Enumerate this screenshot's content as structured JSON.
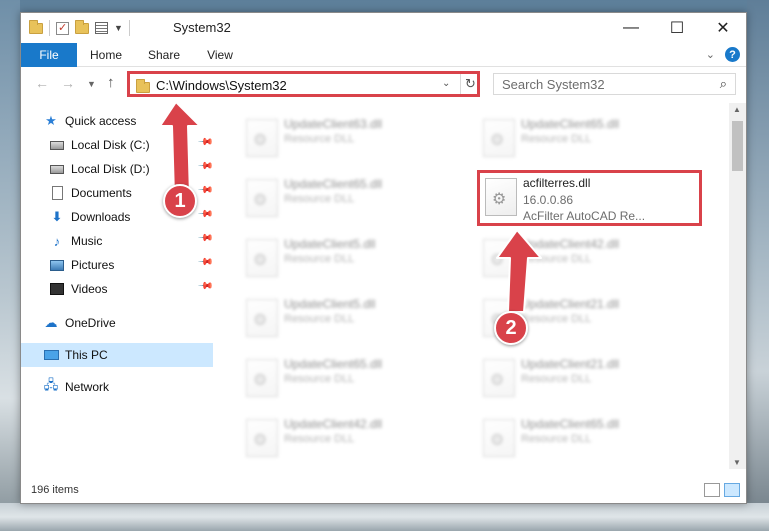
{
  "window": {
    "title": "System32"
  },
  "ribbon": {
    "tabs": [
      "File",
      "Home",
      "Share",
      "View"
    ]
  },
  "titlebar_buttons": {
    "minimize": "—",
    "maximize": "☐",
    "close": "✕"
  },
  "address": {
    "path": "C:\\Windows\\System32",
    "search_placeholder": "Search System32"
  },
  "sidebar": {
    "items": [
      {
        "label": "Quick access",
        "icon": "star-icon"
      },
      {
        "label": "Local Disk (C:)",
        "icon": "drive-icon",
        "pinned": true
      },
      {
        "label": "Local Disk (D:)",
        "icon": "drive-icon",
        "pinned": true
      },
      {
        "label": "Documents",
        "icon": "document-icon",
        "pinned": true
      },
      {
        "label": "Downloads",
        "icon": "download-icon",
        "pinned": true
      },
      {
        "label": "Music",
        "icon": "music-icon",
        "pinned": true
      },
      {
        "label": "Pictures",
        "icon": "pictures-icon",
        "pinned": true
      },
      {
        "label": "Videos",
        "icon": "video-icon",
        "pinned": true
      },
      {
        "label": "OneDrive",
        "icon": "cloud-icon"
      },
      {
        "label": "This PC",
        "icon": "computer-icon",
        "selected": true
      },
      {
        "label": "Network",
        "icon": "network-icon"
      }
    ]
  },
  "files": {
    "left_column": [
      {
        "name": "UpdateClient63.dll",
        "desc": "Resource DLL"
      },
      {
        "name": "UpdateClient65.dll",
        "desc": "Resource DLL"
      },
      {
        "name": "UpdateClient5.dll",
        "desc": "Resource DLL"
      },
      {
        "name": "UpdateClient5.dll",
        "desc": "Resource DLL"
      },
      {
        "name": "UpdateClient65.dll",
        "desc": "Resource DLL"
      },
      {
        "name": "UpdateClient42.dll",
        "desc": "Resource DLL"
      }
    ],
    "right_column": [
      {
        "name": "UpdateClient65.dll",
        "desc": "Resource DLL"
      },
      {
        "name": "UpdateClient42.dll",
        "desc": "Resource DLL"
      },
      {
        "name": "UpdateClient21.dll",
        "desc": "Resource DLL"
      },
      {
        "name": "UpdateClient21.dll",
        "desc": "Resource DLL"
      },
      {
        "name": "UpdateClient65.dll",
        "desc": "Resource DLL"
      }
    ],
    "highlighted": {
      "name": "acfilterres.dll",
      "version": "16.0.0.86",
      "desc": "AcFilter AutoCAD Re..."
    }
  },
  "status": {
    "item_count": "196 items"
  },
  "annotations": {
    "badge1": "1",
    "badge2": "2",
    "color": "#d9424a"
  }
}
